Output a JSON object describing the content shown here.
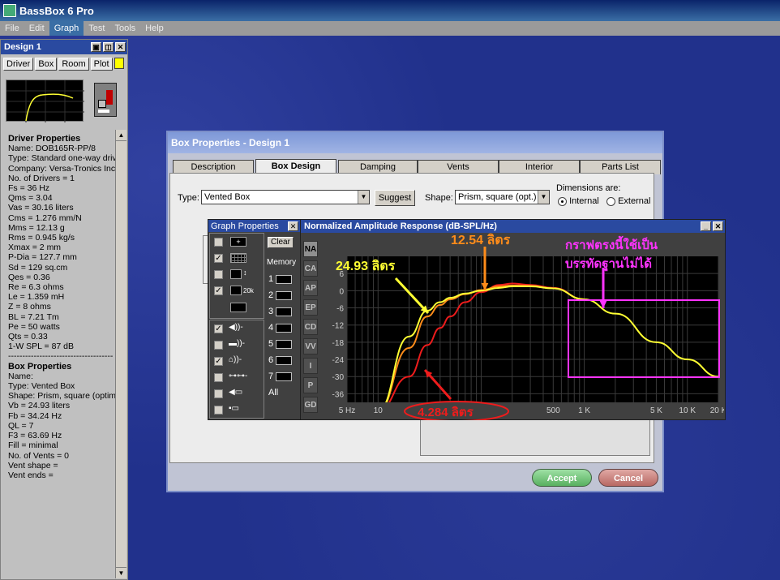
{
  "app": {
    "title": "BassBox 6 Pro"
  },
  "menu": [
    {
      "label": "File"
    },
    {
      "label": "Edit"
    },
    {
      "label": "Graph"
    },
    {
      "label": "Test"
    },
    {
      "label": "Tools"
    },
    {
      "label": "Help"
    }
  ],
  "left_panel": {
    "title": "Design 1",
    "tabs": [
      {
        "label": "Driver"
      },
      {
        "label": "Box"
      },
      {
        "label": "Room"
      },
      {
        "label": "Plot"
      }
    ],
    "driver_heading": "Driver Properties",
    "driver_lines": [
      "Name: DOB165R-PP/8",
      "Type: Standard one-way driv",
      "Company: Versa-Tronics Inc",
      "No. of Drivers = 1",
      "Fs =  36 Hz",
      "Qms =  3.04",
      "Vas =  30.16 liters",
      "Cms =  1.276 mm/N",
      "Mms =  12.13 g",
      "Rms =  0.945 kg/s",
      "Xmax =  2 mm",
      "P-Dia =  127.7 mm",
      "Sd =  129 sq.cm",
      "Qes =  0.36",
      "Re =  6.3 ohms",
      "Le =  1.359 mH",
      "Z =  8 ohms",
      "BL =  7.21 Tm",
      "Pe =  50 watts",
      "Qts =  0.33",
      "1-W SPL =  87 dB"
    ],
    "separator": "-------------------------------------",
    "box_heading": "Box Properties",
    "box_lines": [
      "Name:",
      "Type: Vented Box",
      "Shape: Prism, square (optim",
      "Vb =  24.93 liters",
      "Fb =  34.24 Hz",
      "QL =  7",
      "F3 =  63.69 Hz",
      "Fill = minimal",
      "No. of Vents = 0",
      "   Vent shape =",
      "   Vent ends ="
    ]
  },
  "dialog": {
    "title": "Box Properties - Design 1",
    "tabs": [
      {
        "label": "Description"
      },
      {
        "label": "Box Design"
      },
      {
        "label": "Damping"
      },
      {
        "label": "Vents"
      },
      {
        "label": "Interior"
      },
      {
        "label": "Parts List"
      }
    ],
    "type_label": "Type:",
    "type_value": "Vented Box",
    "suggest_label": "Suggest",
    "shape_label": "Shape:",
    "shape_value": "Prism, square (opt.)",
    "dims_label": "Dimensions are:",
    "dims_internal": "Internal",
    "dims_external": "External",
    "accept_label": "Accept",
    "cancel_label": "Cancel"
  },
  "graph_props": {
    "title": "Graph Properties",
    "clear_label": "Clear",
    "memory_label": "Memory",
    "memory_slots": [
      "1",
      "2",
      "3",
      "4",
      "5",
      "6",
      "7"
    ],
    "all_label": "All",
    "icon_20k": "20k"
  },
  "graph": {
    "title": "Normalized Amplitude Response (dB-SPL/Hz)",
    "side_buttons": [
      {
        "label": "NA"
      },
      {
        "label": "CA"
      },
      {
        "label": "AP"
      },
      {
        "label": "EP"
      },
      {
        "label": "CD"
      },
      {
        "label": "VV"
      },
      {
        "label": "I"
      },
      {
        "label": "P"
      },
      {
        "label": "GD"
      }
    ],
    "y_ticks": [
      "6",
      "0",
      "-6",
      "-12",
      "-18",
      "-24",
      "-30",
      "-36"
    ],
    "x_ticks": [
      "5 Hz",
      "10",
      "500",
      "1 K",
      "5 K",
      "10 K",
      "20 K"
    ],
    "annotations": {
      "yellow": "24.93 ลิตร",
      "orange": "12.54 ลิตร",
      "red": "4.284 ลิตร",
      "magenta_line1": "กราฟตรงนี้ใช้เป็น",
      "magenta_line2": "บรรทัดฐานไม่ได้"
    },
    "colors": {
      "yellow": "#ffff33",
      "orange": "#ff8c1a",
      "red": "#ee1c1c",
      "magenta": "#ff33ff"
    }
  },
  "chart_data": {
    "type": "line",
    "title": "Normalized Amplitude Response (dB-SPL/Hz)",
    "x_scale": "log",
    "xlim": [
      5,
      20000
    ],
    "ylim": [
      -39,
      12
    ],
    "series": [
      {
        "name": "24.93 ลิตร",
        "color": "#ffff33",
        "x": [
          10,
          20,
          30,
          40,
          50,
          70,
          100,
          150,
          200,
          300,
          500,
          1000,
          2000,
          5000,
          10000,
          20000
        ],
        "y": [
          -42,
          -16,
          -7,
          -4,
          -2.5,
          -1,
          0,
          1,
          1.5,
          1.5,
          0.8,
          -3,
          -8,
          -18,
          -24,
          -30
        ]
      },
      {
        "name": "12.54 ลิตร",
        "color": "#ff8c1a",
        "x": [
          10,
          20,
          30,
          40,
          50,
          70,
          100,
          150,
          200,
          300,
          500,
          1000
        ],
        "y": [
          -42,
          -20,
          -9,
          -5,
          -3,
          -1.2,
          0.2,
          1.5,
          1.8,
          1.7,
          0.8,
          -3
        ]
      },
      {
        "name": "4.284 ลิตร",
        "color": "#ee1c1c",
        "x": [
          10,
          20,
          30,
          40,
          50,
          70,
          100,
          150,
          200,
          300,
          500,
          1000
        ],
        "y": [
          -42,
          -30,
          -19,
          -13,
          -9,
          -4,
          -0.5,
          2,
          2.5,
          2,
          1,
          -3
        ]
      }
    ]
  }
}
